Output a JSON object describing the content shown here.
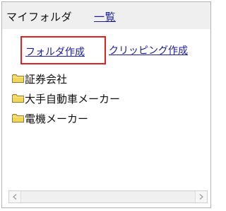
{
  "header": {
    "title": "マイフォルダ",
    "list_link": "一覧"
  },
  "actions": {
    "create_folder": "フォルダ作成",
    "create_clipping": "クリッピング作成"
  },
  "folders": [
    {
      "label": "証券会社",
      "icon": "folder-icon"
    },
    {
      "label": "大手自動車メーカー",
      "icon": "folder-icon"
    },
    {
      "label": "電機メーカー",
      "icon": "folder-icon"
    }
  ],
  "colors": {
    "header_bg": "#efefef",
    "link": "#1f1f9a",
    "highlight_border": "#e22222",
    "folder_fill": "#f2d65c"
  },
  "scrollbar": {
    "left_icon": "arrow-left-icon",
    "right_icon": "arrow-right-icon"
  }
}
